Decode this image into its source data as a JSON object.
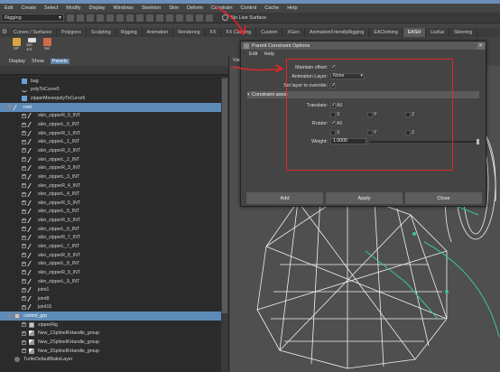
{
  "menubar": [
    "Edit",
    "Create",
    "Select",
    "Modify",
    "Display",
    "Windows",
    "Skeleton",
    "Skin",
    "Deform",
    "Constrain",
    "Control",
    "Cache",
    "Help"
  ],
  "status": {
    "mode": "Rigging",
    "live": "No Live Surface"
  },
  "shelf_tabs": [
    "Curves / Surfaces",
    "Polygons",
    "Sculpting",
    "Rigging",
    "Animation",
    "Rendering",
    "FX",
    "FX Caching",
    "Custom",
    "XGen",
    "AnimationFriendlyRigging",
    "EAClothing",
    "EASH",
    "LiuKai",
    "Skinning"
  ],
  "shelf_active": "EASH",
  "shelf_icons": [
    {
      "label": "SP",
      "icon": "grease-icon",
      "color": "#d9a441"
    },
    {
      "label": "Sel Jnt",
      "icon": "skull-icon",
      "color": "#e0e0e0"
    },
    {
      "label": "Sel",
      "icon": "pencil-icon",
      "color": "#d06b4a"
    }
  ],
  "outliner": {
    "menu": [
      "Display",
      "Show",
      "Panels"
    ],
    "rows": [
      {
        "label": "bag",
        "indent": 2,
        "icon": "mesh",
        "expander": "",
        "selected": false
      },
      {
        "label": "polyToCurve5",
        "indent": 2,
        "icon": "curve",
        "expander": "",
        "selected": false
      },
      {
        "label": "zipperMoverpolyToCurve5",
        "indent": 2,
        "icon": "mesh",
        "expander": "",
        "selected": false
      },
      {
        "label": "root",
        "indent": 1,
        "icon": "joint",
        "expander": "-",
        "selected": true
      },
      {
        "label": "skin_zipperR_0_INT",
        "indent": 3,
        "icon": "joint",
        "expander": "+",
        "selected": false
      },
      {
        "label": "skin_zipperL_0_INT",
        "indent": 3,
        "icon": "joint",
        "expander": "+",
        "selected": false
      },
      {
        "label": "skin_zipperR_1_INT",
        "indent": 3,
        "icon": "joint",
        "expander": "+",
        "selected": false
      },
      {
        "label": "skin_zipperL_1_INT",
        "indent": 3,
        "icon": "joint",
        "expander": "+",
        "selected": false
      },
      {
        "label": "skin_zipperR_2_INT",
        "indent": 3,
        "icon": "joint",
        "expander": "+",
        "selected": false
      },
      {
        "label": "skin_zipperL_2_INT",
        "indent": 3,
        "icon": "joint",
        "expander": "+",
        "selected": false
      },
      {
        "label": "skin_zipperR_3_INT",
        "indent": 3,
        "icon": "joint",
        "expander": "+",
        "selected": false
      },
      {
        "label": "skin_zipperL_3_INT",
        "indent": 3,
        "icon": "joint",
        "expander": "+",
        "selected": false
      },
      {
        "label": "skin_zipperR_4_INT",
        "indent": 3,
        "icon": "joint",
        "expander": "+",
        "selected": false
      },
      {
        "label": "skin_zipperL_4_INT",
        "indent": 3,
        "icon": "joint",
        "expander": "+",
        "selected": false
      },
      {
        "label": "skin_zipperR_5_INT",
        "indent": 3,
        "icon": "joint",
        "expander": "+",
        "selected": false
      },
      {
        "label": "skin_zipperL_5_INT",
        "indent": 3,
        "icon": "joint",
        "expander": "+",
        "selected": false
      },
      {
        "label": "skin_zipperR_6_INT",
        "indent": 3,
        "icon": "joint",
        "expander": "+",
        "selected": false
      },
      {
        "label": "skin_zipperL_6_INT",
        "indent": 3,
        "icon": "joint",
        "expander": "+",
        "selected": false
      },
      {
        "label": "skin_zipperR_7_INT",
        "indent": 3,
        "icon": "joint",
        "expander": "+",
        "selected": false
      },
      {
        "label": "skin_zipperL_7_INT",
        "indent": 3,
        "icon": "joint",
        "expander": "+",
        "selected": false
      },
      {
        "label": "skin_zipperR_8_INT",
        "indent": 3,
        "icon": "joint",
        "expander": "+",
        "selected": false
      },
      {
        "label": "skin_zipperL_8_INT",
        "indent": 3,
        "icon": "joint",
        "expander": "+",
        "selected": false
      },
      {
        "label": "skin_zipperR_9_INT",
        "indent": 3,
        "icon": "joint",
        "expander": "+",
        "selected": false
      },
      {
        "label": "skin_zipperL_9_INT",
        "indent": 3,
        "icon": "joint",
        "expander": "+",
        "selected": false
      },
      {
        "label": "joint1",
        "indent": 3,
        "icon": "joint",
        "expander": "+",
        "selected": false
      },
      {
        "label": "joint8",
        "indent": 3,
        "icon": "joint",
        "expander": "+",
        "selected": false
      },
      {
        "label": "joint15",
        "indent": 3,
        "icon": "joint",
        "expander": "+",
        "selected": false
      },
      {
        "label": "control_grp",
        "indent": 1,
        "icon": "group",
        "expander": "-",
        "selected": true
      },
      {
        "label": "zipperRig",
        "indent": 3,
        "icon": "group",
        "expander": "+",
        "selected": false
      },
      {
        "label": "New_1SplineIKHandle_group",
        "indent": 3,
        "icon": "ikh",
        "expander": "+",
        "selected": false
      },
      {
        "label": "New_2SplineIKHandle_group",
        "indent": 3,
        "icon": "ikh",
        "expander": "+",
        "selected": false
      },
      {
        "label": "New_3SplineIKHandle_group",
        "indent": 3,
        "icon": "ikh",
        "expander": "+",
        "selected": false
      },
      {
        "label": "TurtleDefaultBakeLayer",
        "indent": 1,
        "icon": "bake",
        "expander": "",
        "selected": false
      }
    ]
  },
  "dialog": {
    "title": "Parent Constraint Options",
    "menu": [
      "Edit",
      "Help"
    ],
    "maintain_offset_label": "Maintain offset:",
    "animation_layer_label": "Animation Layer:",
    "animation_layer_value": "None",
    "set_layer_label": "Set layer to override:",
    "section_label": "Constraint axes:",
    "translate_label": "Translate:",
    "rotate_label": "Rotate:",
    "all_label": "All",
    "x_label": "X",
    "y_label": "Y",
    "z_label": "Z",
    "weight_label": "Weight:",
    "weight_value": "1.0000",
    "weight_fraction": 1.0,
    "buttons": {
      "add": "Add",
      "apply": "Apply",
      "close": "Close"
    }
  },
  "viewport_label": "Vie",
  "annotation_color": "#e0262a"
}
